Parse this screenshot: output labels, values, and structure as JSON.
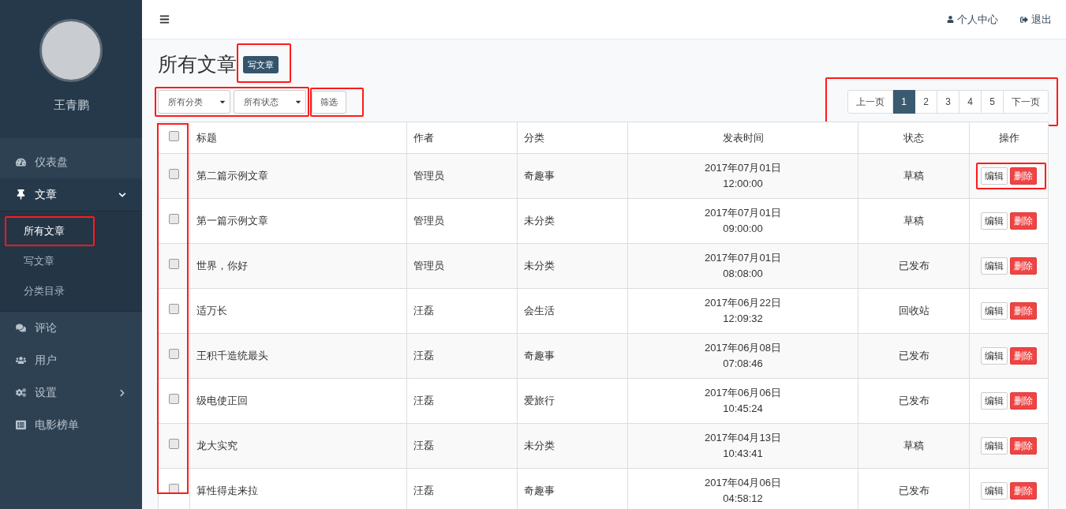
{
  "sidebar": {
    "user_name": "王青鹏",
    "items": [
      {
        "label": "仪表盘",
        "selected": false
      },
      {
        "label": "文章",
        "selected": true,
        "expanded": true,
        "children": [
          {
            "label": "所有文章",
            "selected": true,
            "highlighted": true
          },
          {
            "label": "写文章",
            "selected": false,
            "highlighted": false
          },
          {
            "label": "分类目录",
            "selected": false,
            "highlighted": false
          }
        ]
      },
      {
        "label": "评论",
        "selected": false
      },
      {
        "label": "用户",
        "selected": false
      },
      {
        "label": "设置",
        "selected": false,
        "expanded": false
      },
      {
        "label": "电影榜单",
        "selected": false
      }
    ]
  },
  "topbar": {
    "profile_link": "个人中心",
    "logout_link": "退出"
  },
  "page": {
    "title": "所有文章",
    "new_button": {
      "label": "写文章",
      "highlighted": true
    }
  },
  "filters": {
    "highlighted": true,
    "selects": [
      {
        "value": "所有分类"
      },
      {
        "value": "所有状态"
      }
    ],
    "filter_button": {
      "label": "筛选",
      "highlighted": true
    }
  },
  "pagination": {
    "highlighted": true,
    "prev": "上一页",
    "next": "下一页",
    "pages": [
      {
        "label": "1",
        "selected": true
      },
      {
        "label": "2",
        "selected": false
      },
      {
        "label": "3",
        "selected": false
      },
      {
        "label": "4",
        "selected": false
      },
      {
        "label": "5",
        "selected": false
      }
    ]
  },
  "table": {
    "checkbox_column_highlighted": true,
    "header_checked": false,
    "columns": [
      "标题",
      "作者",
      "分类",
      "发表时间",
      "状态",
      "操作"
    ],
    "rows": [
      {
        "checked": false,
        "title": "第二篇示例文章",
        "author": "管理员",
        "category": "奇趣事",
        "date": "2017年07月01日",
        "time": "12:00:00",
        "status": "草稿",
        "actions_highlighted": true,
        "edit": "编辑",
        "delete": "删除"
      },
      {
        "checked": false,
        "title": "第一篇示例文章",
        "author": "管理员",
        "category": "未分类",
        "date": "2017年07月01日",
        "time": "09:00:00",
        "status": "草稿",
        "actions_highlighted": false,
        "edit": "编辑",
        "delete": "删除"
      },
      {
        "checked": false,
        "title": "世界，你好",
        "author": "管理员",
        "category": "未分类",
        "date": "2017年07月01日",
        "time": "08:08:00",
        "status": "已发布",
        "actions_highlighted": false,
        "edit": "编辑",
        "delete": "删除"
      },
      {
        "checked": false,
        "title": "适万长",
        "author": "汪磊",
        "category": "会生活",
        "date": "2017年06月22日",
        "time": "12:09:32",
        "status": "回收站",
        "actions_highlighted": false,
        "edit": "编辑",
        "delete": "删除"
      },
      {
        "checked": false,
        "title": "王积千造统最头",
        "author": "汪磊",
        "category": "奇趣事",
        "date": "2017年06月08日",
        "time": "07:08:46",
        "status": "已发布",
        "actions_highlighted": false,
        "edit": "编辑",
        "delete": "删除"
      },
      {
        "checked": false,
        "title": "级电使正回",
        "author": "汪磊",
        "category": "爱旅行",
        "date": "2017年06月06日",
        "time": "10:45:24",
        "status": "已发布",
        "actions_highlighted": false,
        "edit": "编辑",
        "delete": "删除"
      },
      {
        "checked": false,
        "title": "龙大实究",
        "author": "汪磊",
        "category": "未分类",
        "date": "2017年04月13日",
        "time": "10:43:41",
        "status": "草稿",
        "actions_highlighted": false,
        "edit": "编辑",
        "delete": "删除"
      },
      {
        "checked": false,
        "title": "算性得走来拉",
        "author": "汪磊",
        "category": "奇趣事",
        "date": "2017年04月06日",
        "time": "04:58:12",
        "status": "已发布",
        "actions_highlighted": false,
        "edit": "编辑",
        "delete": "删除"
      }
    ]
  }
}
